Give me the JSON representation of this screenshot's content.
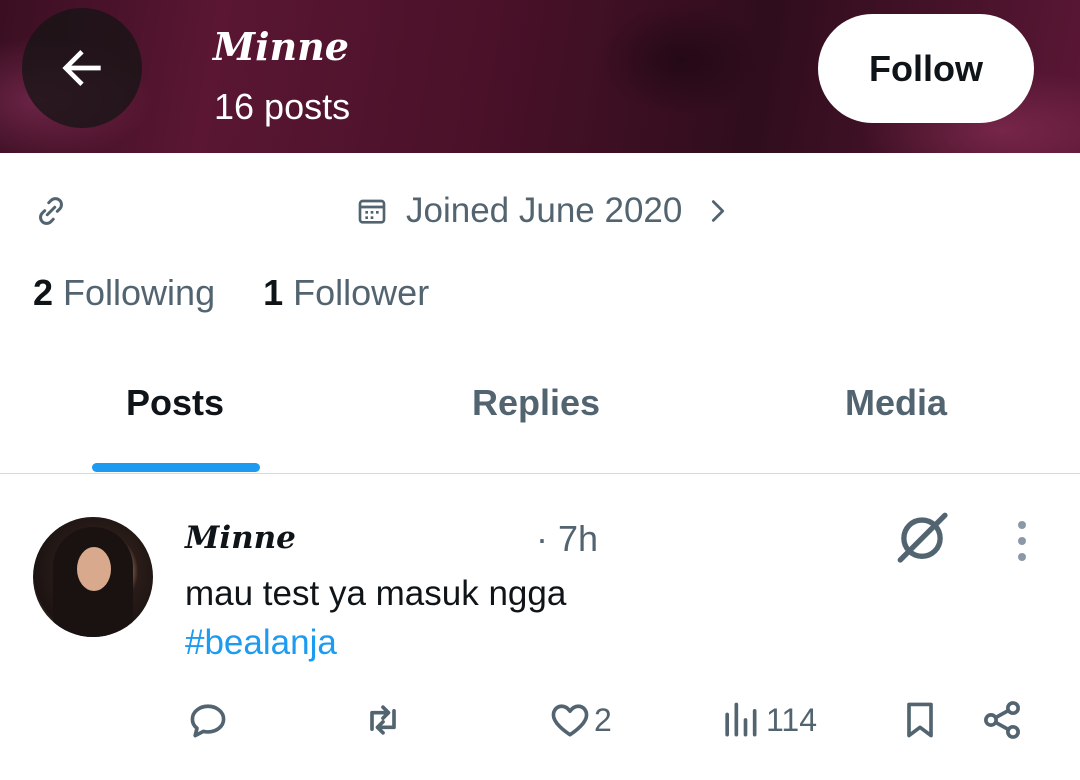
{
  "header": {
    "name": "Minne",
    "posts_count": "16 posts",
    "follow_label": "Follow"
  },
  "profile": {
    "joined": "Joined June 2020",
    "following_count": "2",
    "following_label": "Following",
    "followers_count": "1",
    "followers_label": "Follower"
  },
  "tabs": [
    {
      "label": "Posts",
      "active": true
    },
    {
      "label": "Replies",
      "active": false
    },
    {
      "label": "Media",
      "active": false
    }
  ],
  "post": {
    "author": "Minne",
    "time": "· 7h",
    "text": "mau test ya masuk ngga",
    "hashtag": "#bealanja",
    "likes": "2",
    "views": "114"
  },
  "colors": {
    "accent": "#1d9bf0",
    "secondary_text": "#536471",
    "primary_text": "#0f1419"
  }
}
